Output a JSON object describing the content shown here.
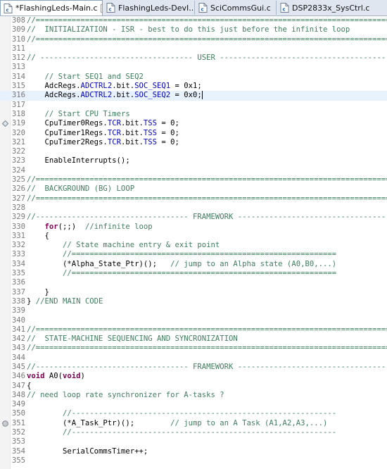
{
  "tabs": [
    {
      "label": "*FlashingLeds-Main.c",
      "active": true,
      "close": "☒"
    },
    {
      "label": "FlashingLeds-DevI...",
      "active": false
    },
    {
      "label": "SciCommsGui.c",
      "active": false
    },
    {
      "label": "DSP2833x_SysCtrl.c",
      "active": false
    }
  ],
  "colors": {
    "comment": "#3f7f5f",
    "keyword": "#7f0055",
    "field": "#0000c0",
    "line_number": "#787878",
    "current_line": "#e8f2fe"
  },
  "lines": [
    {
      "n": "308",
      "segs": [
        {
          "t": "//===============================================================================",
          "c": "c"
        }
      ]
    },
    {
      "n": "309",
      "segs": [
        {
          "t": "//  INITIALIZATION - ISR - best to do this just before the infinite loop",
          "c": "c"
        }
      ]
    },
    {
      "n": "310",
      "segs": [
        {
          "t": "//===============================================================================",
          "c": "c"
        }
      ]
    },
    {
      "n": "311",
      "segs": []
    },
    {
      "n": "312",
      "segs": [
        {
          "t": "// ---------------------------------- USER ------------------------------------------",
          "c": "c"
        }
      ]
    },
    {
      "n": "313",
      "segs": []
    },
    {
      "n": "314",
      "segs": [
        {
          "t": "    "
        },
        {
          "t": "// Start SEQ1 and SEQ2",
          "c": "c"
        }
      ]
    },
    {
      "n": "315",
      "segs": [
        {
          "t": "    AdcRegs."
        },
        {
          "t": "ADCTRL2",
          "c": "f"
        },
        {
          "t": ".bit."
        },
        {
          "t": "SOC_SEQ1",
          "c": "f"
        },
        {
          "t": " = 0x1;"
        }
      ]
    },
    {
      "n": "316",
      "cur": true,
      "segs": [
        {
          "t": "    AdcRegs."
        },
        {
          "t": "ADCTRL2",
          "c": "f"
        },
        {
          "t": ".bit."
        },
        {
          "t": "SOC_SEQ2",
          "c": "f"
        },
        {
          "t": " = 0x0;"
        }
      ]
    },
    {
      "n": "317",
      "segs": []
    },
    {
      "n": "318",
      "segs": [
        {
          "t": "    "
        },
        {
          "t": "// Start CPU Timers",
          "c": "c"
        }
      ]
    },
    {
      "n": "319",
      "marker": "diamond",
      "segs": [
        {
          "t": "    CpuTimer0Regs."
        },
        {
          "t": "TCR",
          "c": "f"
        },
        {
          "t": ".bit."
        },
        {
          "t": "TSS",
          "c": "f"
        },
        {
          "t": " = 0;"
        }
      ]
    },
    {
      "n": "320",
      "segs": [
        {
          "t": "    CpuTimer1Regs."
        },
        {
          "t": "TCR",
          "c": "f"
        },
        {
          "t": ".bit."
        },
        {
          "t": "TSS",
          "c": "f"
        },
        {
          "t": " = 0;"
        }
      ]
    },
    {
      "n": "321",
      "segs": [
        {
          "t": "    CpuTimer2Regs."
        },
        {
          "t": "TCR",
          "c": "f"
        },
        {
          "t": ".bit."
        },
        {
          "t": "TSS",
          "c": "f"
        },
        {
          "t": " = 0;"
        }
      ]
    },
    {
      "n": "322",
      "segs": []
    },
    {
      "n": "323",
      "segs": [
        {
          "t": "    EnableInterrupts();"
        }
      ]
    },
    {
      "n": "324",
      "segs": []
    },
    {
      "n": "325",
      "segs": [
        {
          "t": "//===============================================================================",
          "c": "c"
        }
      ]
    },
    {
      "n": "326",
      "segs": [
        {
          "t": "//  BACKGROUND (BG) LOOP",
          "c": "c"
        }
      ]
    },
    {
      "n": "327",
      "segs": [
        {
          "t": "//===============================================================================",
          "c": "c"
        }
      ]
    },
    {
      "n": "328",
      "segs": []
    },
    {
      "n": "329",
      "segs": [
        {
          "t": "//---------------------------------- FRAMEWORK --------------------------------------",
          "c": "c"
        }
      ]
    },
    {
      "n": "330",
      "segs": [
        {
          "t": "    "
        },
        {
          "t": "for",
          "c": "k"
        },
        {
          "t": "(;;)  "
        },
        {
          "t": "//infinite loop",
          "c": "c"
        }
      ]
    },
    {
      "n": "331",
      "segs": [
        {
          "t": "    {"
        }
      ]
    },
    {
      "n": "332",
      "segs": [
        {
          "t": "        "
        },
        {
          "t": "// State machine entry & exit point",
          "c": "c"
        }
      ]
    },
    {
      "n": "333",
      "segs": [
        {
          "t": "        "
        },
        {
          "t": "//===========================================================",
          "c": "c"
        }
      ]
    },
    {
      "n": "334",
      "segs": [
        {
          "t": "        (*Alpha_State_Ptr)();   "
        },
        {
          "t": "// jump to an Alpha state (A0,B0,...)",
          "c": "c"
        }
      ]
    },
    {
      "n": "335",
      "segs": [
        {
          "t": "        "
        },
        {
          "t": "//===========================================================",
          "c": "c"
        }
      ]
    },
    {
      "n": "336",
      "segs": []
    },
    {
      "n": "337",
      "segs": [
        {
          "t": "    }"
        }
      ]
    },
    {
      "n": "338",
      "segs": [
        {
          "t": "} "
        },
        {
          "t": "//END MAIN CODE",
          "c": "c"
        }
      ]
    },
    {
      "n": "339",
      "segs": []
    },
    {
      "n": "340",
      "segs": []
    },
    {
      "n": "341",
      "segs": [
        {
          "t": "//===============================================================================",
          "c": "c"
        }
      ]
    },
    {
      "n": "342",
      "segs": [
        {
          "t": "//  STATE-MACHINE SEQUENCING AND SYNCRONIZATION",
          "c": "c"
        }
      ]
    },
    {
      "n": "343",
      "segs": [
        {
          "t": "//===============================================================================",
          "c": "c"
        }
      ]
    },
    {
      "n": "344",
      "segs": []
    },
    {
      "n": "345",
      "segs": [
        {
          "t": "//---------------------------------- FRAMEWORK --------------------------------------",
          "c": "c"
        }
      ]
    },
    {
      "n": "346",
      "segs": [
        {
          "t": "void",
          "c": "k"
        },
        {
          "t": " A0("
        },
        {
          "t": "void",
          "c": "k"
        },
        {
          "t": ")"
        }
      ]
    },
    {
      "n": "347",
      "segs": [
        {
          "t": "{"
        }
      ]
    },
    {
      "n": "348",
      "segs": [
        {
          "t": "// need loop rate synchronizer for A-tasks ?",
          "c": "c"
        }
      ]
    },
    {
      "n": "349",
      "segs": []
    },
    {
      "n": "350",
      "segs": [
        {
          "t": "        "
        },
        {
          "t": "//-----------------------------------------------------------",
          "c": "c"
        }
      ]
    },
    {
      "n": "351",
      "marker": "circle",
      "segs": [
        {
          "t": "        (*A_Task_Ptr)();        "
        },
        {
          "t": "// jump to an A Task (A1,A2,A3,...)",
          "c": "c"
        }
      ]
    },
    {
      "n": "352",
      "segs": [
        {
          "t": "        "
        },
        {
          "t": "//-----------------------------------------------------------",
          "c": "c"
        }
      ]
    },
    {
      "n": "353",
      "segs": []
    },
    {
      "n": "354",
      "segs": [
        {
          "t": "        SerialCommsTimer++;"
        }
      ]
    },
    {
      "n": "355",
      "segs": []
    }
  ]
}
